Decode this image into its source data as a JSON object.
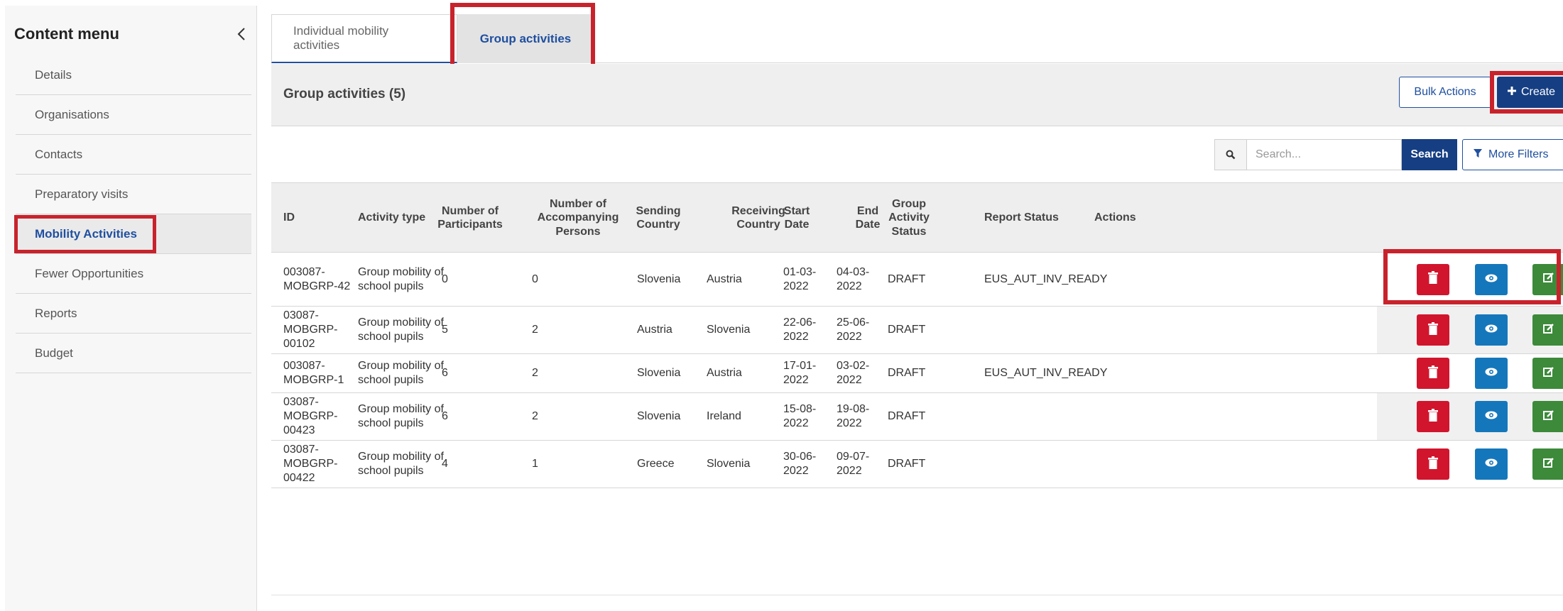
{
  "sidebar": {
    "title": "Content menu",
    "items": [
      {
        "label": "Details"
      },
      {
        "label": "Organisations"
      },
      {
        "label": "Contacts"
      },
      {
        "label": "Preparatory visits"
      },
      {
        "label": "Mobility Activities",
        "active": true
      },
      {
        "label": "Fewer Opportunities"
      },
      {
        "label": "Reports"
      },
      {
        "label": "Budget"
      }
    ]
  },
  "tabs": [
    {
      "label": "Individual mobility activities",
      "active": false
    },
    {
      "label": "Group activities",
      "active": true
    }
  ],
  "panel": {
    "title": "Group activities (5)",
    "bulk_label": "Bulk Actions",
    "create_label": "Create"
  },
  "search": {
    "placeholder": "Search...",
    "button_label": "Search",
    "filters_label": "More Filters"
  },
  "table": {
    "columns": [
      "ID",
      "Activity type",
      "Number of Participants",
      "Number of Accompanying Persons",
      "Sending Country",
      "Receiving Country",
      "Start Date",
      "End Date",
      "Group Activity Status",
      "Report Status",
      "Actions"
    ],
    "rows": [
      {
        "id": "003087-MOBGRP-42",
        "type": "Group mobility of school pupils",
        "participants": "0",
        "accompanying": "0",
        "sending": "Slovenia",
        "receiving": "Austria",
        "start": "01-03-2022",
        "end": "04-03-2022",
        "status": "DRAFT",
        "report": "EUS_AUT_INV_READY"
      },
      {
        "id": "03087-MOBGRP-00102",
        "type": "Group mobility of school pupils",
        "participants": "5",
        "accompanying": "2",
        "sending": "Austria",
        "receiving": "Slovenia",
        "start": "22-06-2022",
        "end": "25-06-2022",
        "status": "DRAFT",
        "report": ""
      },
      {
        "id": "003087-MOBGRP-1",
        "type": "Group mobility of school pupils",
        "participants": "6",
        "accompanying": "2",
        "sending": "Slovenia",
        "receiving": "Austria",
        "start": "17-01-2022",
        "end": "03-02-2022",
        "status": "DRAFT",
        "report": "EUS_AUT_INV_READY"
      },
      {
        "id": "03087-MOBGRP-00423",
        "type": "Group mobility of school pupils",
        "participants": "6",
        "accompanying": "2",
        "sending": "Slovenia",
        "receiving": "Ireland",
        "start": "15-08-2022",
        "end": "19-08-2022",
        "status": "DRAFT",
        "report": ""
      },
      {
        "id": "03087-MOBGRP-00422",
        "type": "Group mobility of school pupils",
        "participants": "4",
        "accompanying": "1",
        "sending": "Greece",
        "receiving": "Slovenia",
        "start": "30-06-2022",
        "end": "09-07-2022",
        "status": "DRAFT",
        "report": ""
      }
    ]
  },
  "colors": {
    "brand_blue": "#163e83",
    "highlight_red": "#c8232c",
    "delete_red": "#d1152d",
    "view_blue": "#1577bb",
    "edit_green": "#3c8a3a"
  },
  "icons": {
    "collapse": "chevron-left-icon",
    "create": "plus-icon",
    "search": "search-icon",
    "filters": "filter-icon",
    "delete": "trash-icon",
    "view": "eye-icon",
    "edit": "edit-icon"
  }
}
